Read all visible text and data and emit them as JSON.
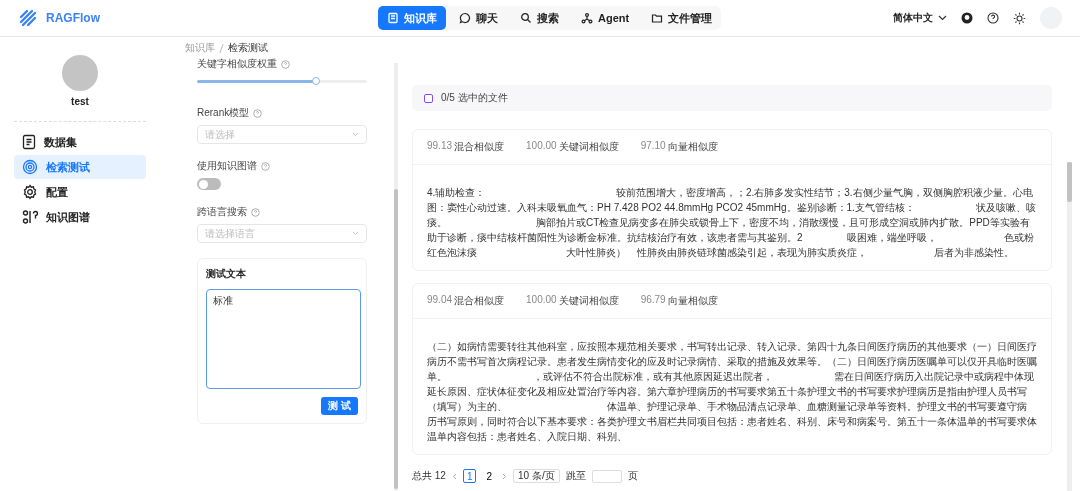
{
  "header": {
    "logo": "RAGFlow",
    "tabs": [
      {
        "label": "知识库",
        "selected": true
      },
      {
        "label": "聊天",
        "selected": false
      },
      {
        "label": "搜索",
        "selected": false
      },
      {
        "label": "Agent",
        "selected": false
      },
      {
        "label": "文件管理",
        "selected": false
      }
    ],
    "language": "简体中文"
  },
  "sidebar": {
    "user": "test",
    "items": [
      {
        "label": "数据集",
        "selected": false
      },
      {
        "label": "检索测试",
        "selected": true
      },
      {
        "label": "配置",
        "selected": false
      },
      {
        "label": "知识图谱",
        "selected": false
      }
    ]
  },
  "breadcrumb": [
    "知识库",
    "检索测试"
  ],
  "settings": {
    "slider": {
      "label": "关键字相似度权重",
      "level": 0.7
    },
    "rerank": {
      "label": "Rerank模型",
      "placeholder": "请选择"
    },
    "graph": {
      "label": "使用知识图谱",
      "on": false
    },
    "cross_language": {
      "label": "跨语言搜索",
      "placeholder": "请选择语言"
    },
    "test_text": {
      "label": "测试文本",
      "value": "标准",
      "button": "测 试"
    }
  },
  "results": {
    "selection": "0/5 选中的文件",
    "checked": false,
    "chunks": [
      {
        "scores": [
          {
            "value": "99.13",
            "label": "混合相似度"
          },
          {
            "value": "100.00",
            "label": "关键词相似度"
          },
          {
            "value": "97.10",
            "label": "向量相似度"
          }
        ],
        "text": "4.辅助检查：                                               较前范围增大，密度增高，；2.右肺多发实性结节；3.右侧少量气胸，双侧胸腔积液少量。心电图：窦性心动过速。入科未吸氧血气：PH 7.428 PO2 44.8mmHg PCO2 45mmHg。鉴别诊断：1.支气管结核：                      状及咳嗽、咳痰。                                胸部拍片或CT检查见病变多在肺尖或锁骨上下，密度不均，消散缓慢，且可形成空洞或肺内扩散。PPD等实验有助于诊断，痰中结核杆菌阳性为诊断金标准。抗结核治疗有效，该患者需与其鉴别。2                吸困难，端坐呼吸，                        色或粉红色泡沫痰                                大叶性肺炎）    性肺炎由肺炎链球菌感染引起，表现为肺实质炎症，                        后者为非感染性。"
      },
      {
        "scores": [
          {
            "value": "99.04",
            "label": "混合相似度"
          },
          {
            "value": "100.00",
            "label": "关键词相似度"
          },
          {
            "value": "96.79",
            "label": "向量相似度"
          }
        ],
        "text": "（二）如病情需要转往其他科室，应按照本规范相关要求，书写转出记录、转入记录。第四十九条日间医疗病历的其他要求（一）日间医疗病历不需书写首次病程记录。患者发生病情变化的应及时记录病情、采取的措施及效果等。（二）日间医疗病历医嘱单可以仅开具临时医嘱单。                               ，或评估不符合出院标准，或有其他原因延迟出院者，                      需在日间医疗病历入出院记录中或病程中体现延长原因、症状体征变化及相应处置治疗等内容。第六章护理病历的书写要求第五十条护理文书的书写要求护理病历是指由护理人员书写（填写）为主的、                                    体温单、护理记录单、手术物品清点记录单、血糖测量记录单等资料。护理文书的书写要遵守病历书写原则，同时符合以下基本要求：各类护理文书眉栏共同项目包括：患者姓名、科别、床号和病案号。第五十一条体温单的书写要求体温单内容包括：患者姓名、入院日期、科别、"
      }
    ]
  },
  "pagination": {
    "total": "总共 12",
    "pages": [
      {
        "label": "1",
        "selected": true
      },
      {
        "label": "2",
        "selected": false
      }
    ],
    "page_size": "10 条/页",
    "jump": "跳至",
    "unit": "页"
  }
}
